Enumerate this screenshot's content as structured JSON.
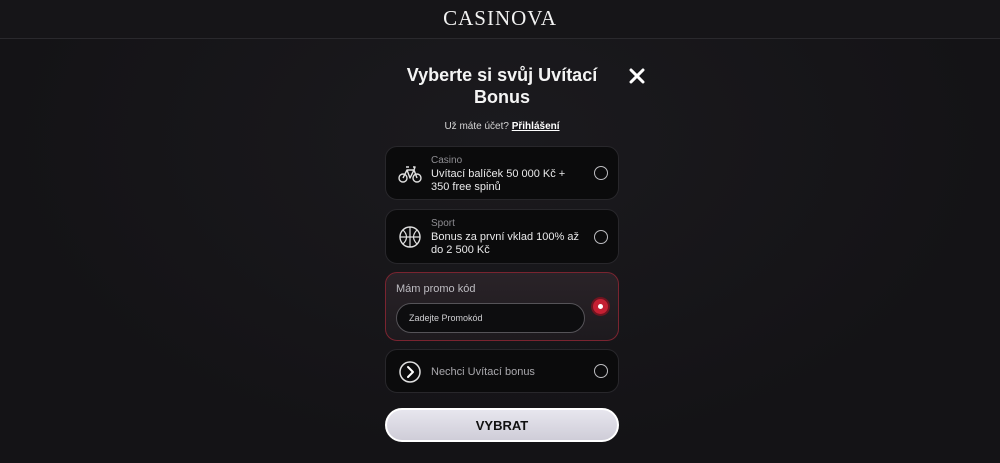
{
  "brand": {
    "logo_text": "CASINOVA"
  },
  "dialog": {
    "title": "Vyberte si svůj Uvítací Bonus",
    "close_icon": "close-icon",
    "login_prompt": "Už máte účet?",
    "login_link": "Přihlášení"
  },
  "options": [
    {
      "category": "Casino",
      "text": "Uvítací balíček 50 000 Kč + 350 free spinů",
      "icon": "bicycle-icon",
      "selected": false
    },
    {
      "category": "Sport",
      "text": "Bonus za první vklad 100% až do 2 500 Kč",
      "icon": "basketball-icon",
      "selected": false
    }
  ],
  "promo": {
    "label": "Mám promo kód",
    "placeholder": "Zadejte Promokód",
    "value": "",
    "selected": true,
    "accent_color": "#c52033"
  },
  "no_bonus": {
    "text": "Nechci Uvítací bonus",
    "icon": "chevron-right-icon",
    "selected": false
  },
  "submit": {
    "label": "VYBRAT"
  }
}
